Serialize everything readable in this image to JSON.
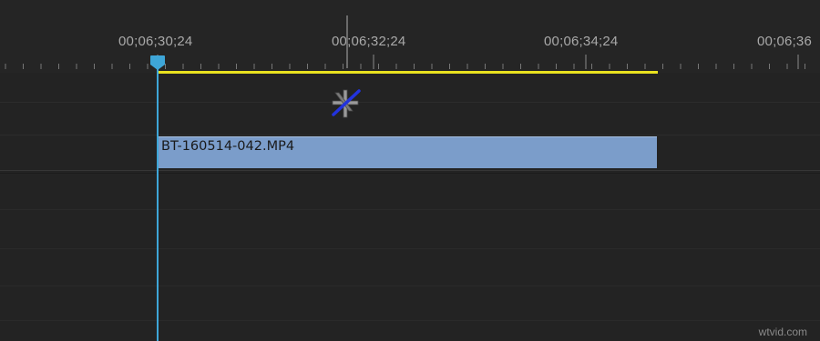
{
  "timeline": {
    "ruler": {
      "timecodes": [
        "00;06;30;24",
        "00;06;32;24",
        "00;06;34;24",
        "00;06;36"
      ]
    },
    "clip": {
      "name": "BT-160514-042.MP4"
    },
    "icons": {
      "effect_disabled": "fx-disabled-icon",
      "playhead": "playhead-icon"
    }
  },
  "colors": {
    "background": "#232323",
    "clip": "#7b9dca",
    "work_area_bar": "#e9e21f",
    "playhead": "#3ea6d8"
  },
  "watermark": "wtvid.com"
}
